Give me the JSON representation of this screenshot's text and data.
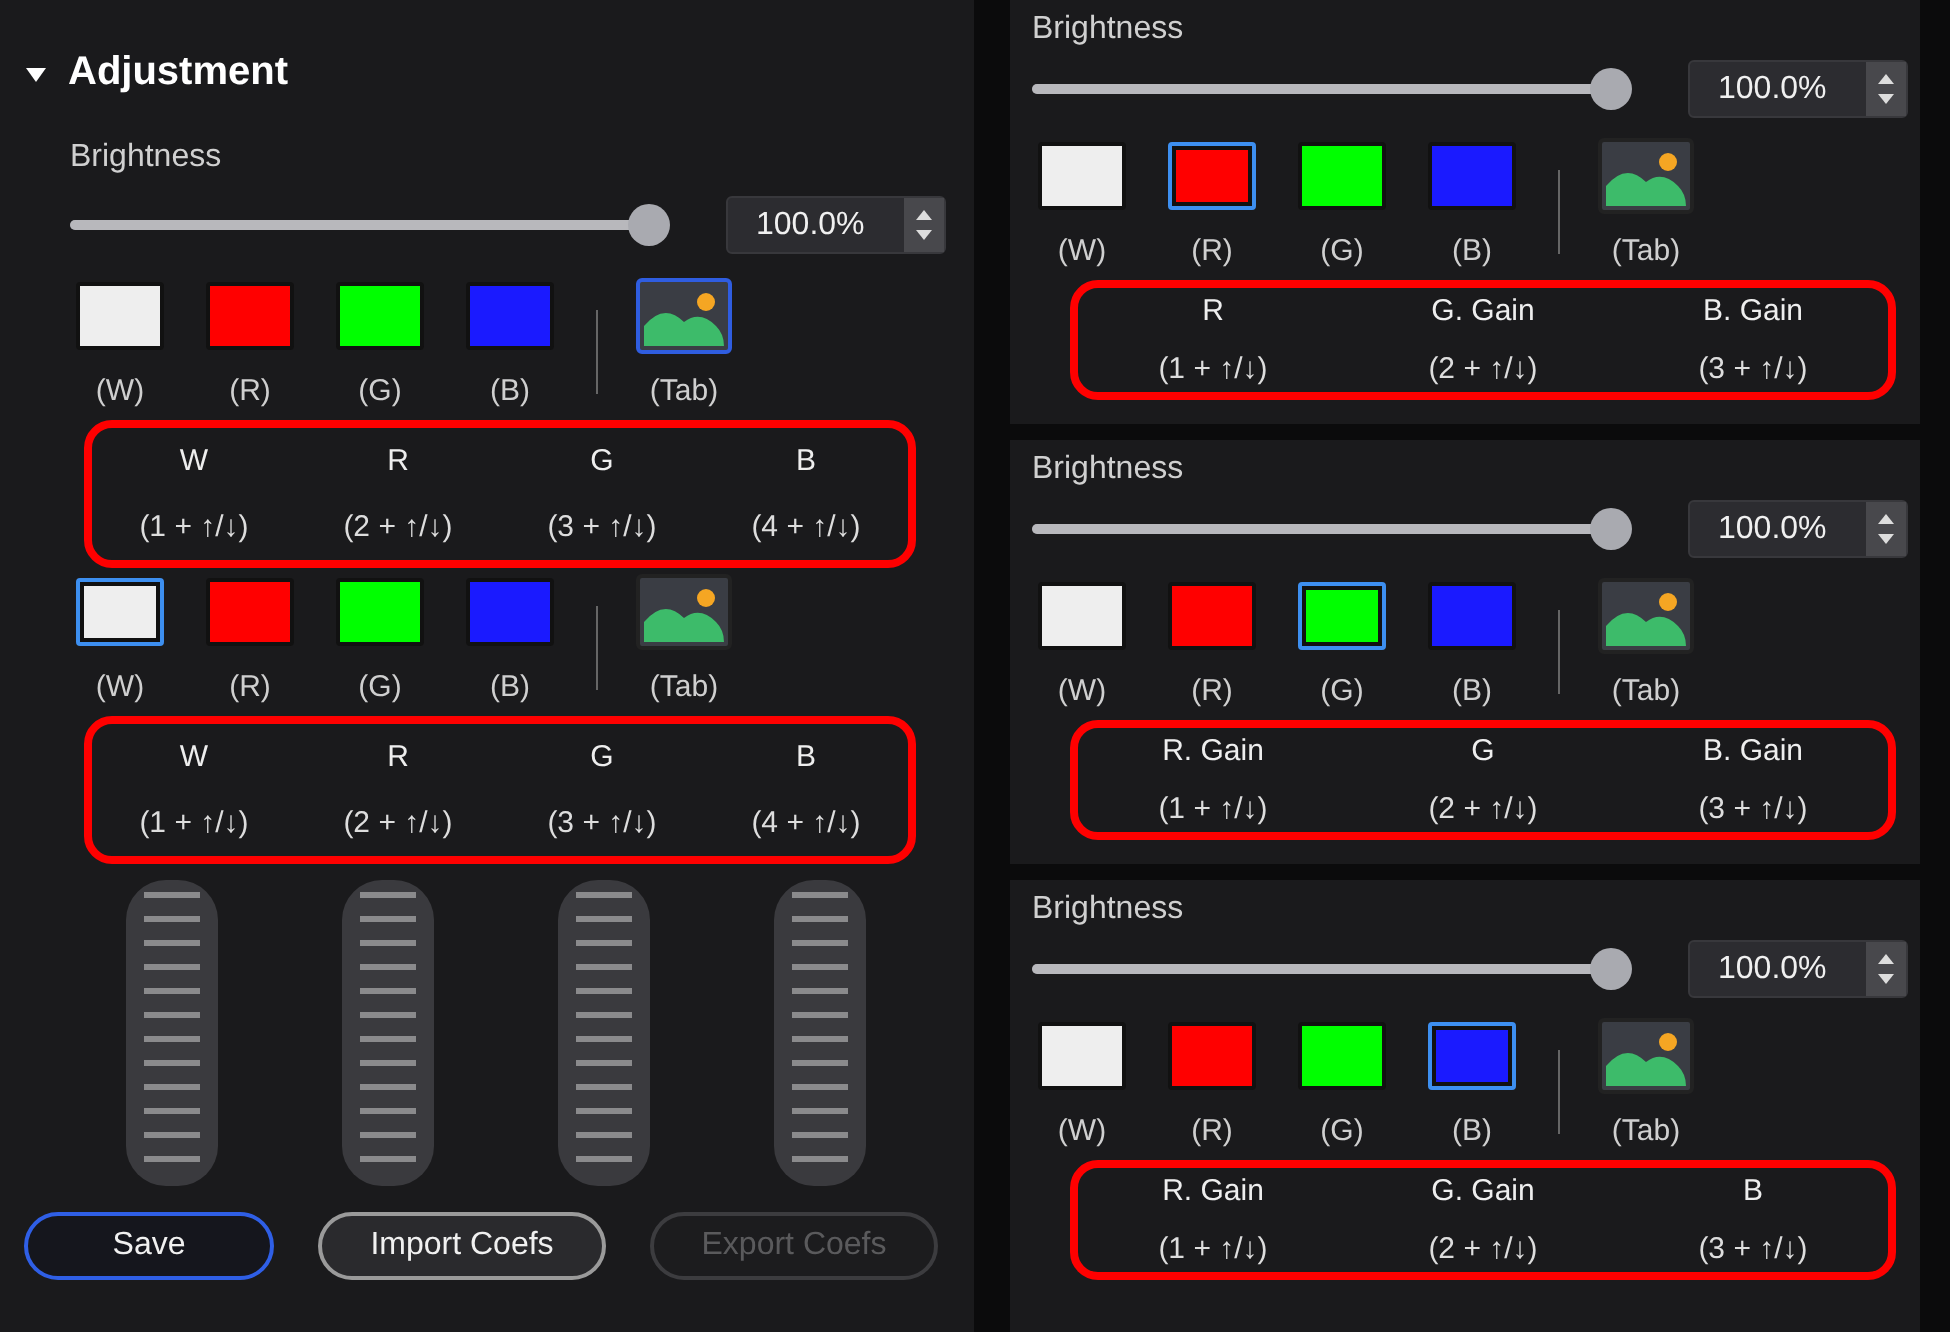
{
  "left": {
    "header": {
      "title": "Adjustment",
      "expanded": true
    },
    "brightness": {
      "label": "Brightness",
      "level": 1,
      "value": "100.0%"
    },
    "groups": [
      {
        "swatches": [
          {
            "label": "(W)",
            "kind": "color",
            "color": "#eeeeee",
            "selected": false
          },
          {
            "label": "(R)",
            "kind": "color",
            "color": "#ff0000",
            "selected": false
          },
          {
            "label": "(G)",
            "kind": "color",
            "color": "#00ff00",
            "selected": false
          },
          {
            "label": "(B)",
            "kind": "color",
            "color": "#1a1aff",
            "selected": false
          },
          {
            "label": "(Tab)",
            "kind": "image",
            "selected": true
          }
        ],
        "channels": [
          {
            "name": "W",
            "hint": "(1 + ↑/↓)"
          },
          {
            "name": "R",
            "hint": "(2 + ↑/↓)"
          },
          {
            "name": "G",
            "hint": "(3 + ↑/↓)"
          },
          {
            "name": "B",
            "hint": "(4 + ↑/↓)"
          }
        ]
      },
      {
        "swatches": [
          {
            "label": "(W)",
            "kind": "color",
            "color": "#eeeeee",
            "selected": true
          },
          {
            "label": "(R)",
            "kind": "color",
            "color": "#ff0000",
            "selected": false
          },
          {
            "label": "(G)",
            "kind": "color",
            "color": "#00ff00",
            "selected": false
          },
          {
            "label": "(B)",
            "kind": "color",
            "color": "#1a1aff",
            "selected": false
          },
          {
            "label": "(Tab)",
            "kind": "image",
            "selected": false
          }
        ],
        "channels": [
          {
            "name": "W",
            "hint": "(1 + ↑/↓)"
          },
          {
            "name": "R",
            "hint": "(2 + ↑/↓)"
          },
          {
            "name": "G",
            "hint": "(3 + ↑/↓)"
          },
          {
            "name": "B",
            "hint": "(4 + ↑/↓)"
          }
        ]
      }
    ],
    "buttons": [
      {
        "label": "Save",
        "kind": "primary",
        "disabled": false
      },
      {
        "label": "Import Coefs",
        "kind": "secondary",
        "disabled": false
      },
      {
        "label": "Export Coefs",
        "kind": "secondary",
        "disabled": true
      }
    ]
  },
  "right": [
    {
      "brightness": {
        "label": "Brightness",
        "level": 1,
        "value": "100.0%"
      },
      "swatches": [
        {
          "label": "(W)",
          "kind": "color",
          "color": "#eeeeee",
          "selected": false
        },
        {
          "label": "(R)",
          "kind": "color",
          "color": "#ff0000",
          "selected": true
        },
        {
          "label": "(G)",
          "kind": "color",
          "color": "#00ff00",
          "selected": false
        },
        {
          "label": "(B)",
          "kind": "color",
          "color": "#1a1aff",
          "selected": false
        },
        {
          "label": "(Tab)",
          "kind": "image",
          "selected": false
        }
      ],
      "channels": [
        {
          "name": "R",
          "hint": "(1 + ↑/↓)"
        },
        {
          "name": "G. Gain",
          "hint": "(2 + ↑/↓)"
        },
        {
          "name": "B. Gain",
          "hint": "(3 + ↑/↓)"
        }
      ]
    },
    {
      "brightness": {
        "label": "Brightness",
        "level": 1,
        "value": "100.0%"
      },
      "swatches": [
        {
          "label": "(W)",
          "kind": "color",
          "color": "#eeeeee",
          "selected": false
        },
        {
          "label": "(R)",
          "kind": "color",
          "color": "#ff0000",
          "selected": false
        },
        {
          "label": "(G)",
          "kind": "color",
          "color": "#00ff00",
          "selected": true
        },
        {
          "label": "(B)",
          "kind": "color",
          "color": "#1a1aff",
          "selected": false
        },
        {
          "label": "(Tab)",
          "kind": "image",
          "selected": false
        }
      ],
      "channels": [
        {
          "name": "R. Gain",
          "hint": "(1 + ↑/↓)"
        },
        {
          "name": "G",
          "hint": "(2 + ↑/↓)"
        },
        {
          "name": "B. Gain",
          "hint": "(3 + ↑/↓)"
        }
      ]
    },
    {
      "brightness": {
        "label": "Brightness",
        "level": 1,
        "value": "100.0%"
      },
      "swatches": [
        {
          "label": "(W)",
          "kind": "color",
          "color": "#eeeeee",
          "selected": false
        },
        {
          "label": "(R)",
          "kind": "color",
          "color": "#ff0000",
          "selected": false
        },
        {
          "label": "(G)",
          "kind": "color",
          "color": "#00ff00",
          "selected": false
        },
        {
          "label": "(B)",
          "kind": "color",
          "color": "#1a1aff",
          "selected": true
        },
        {
          "label": "(Tab)",
          "kind": "image",
          "selected": false
        }
      ],
      "channels": [
        {
          "name": "R. Gain",
          "hint": "(1 + ↑/↓)"
        },
        {
          "name": "G. Gain",
          "hint": "(2 + ↑/↓)"
        },
        {
          "name": "B",
          "hint": "(3 + ↑/↓)"
        }
      ]
    }
  ]
}
